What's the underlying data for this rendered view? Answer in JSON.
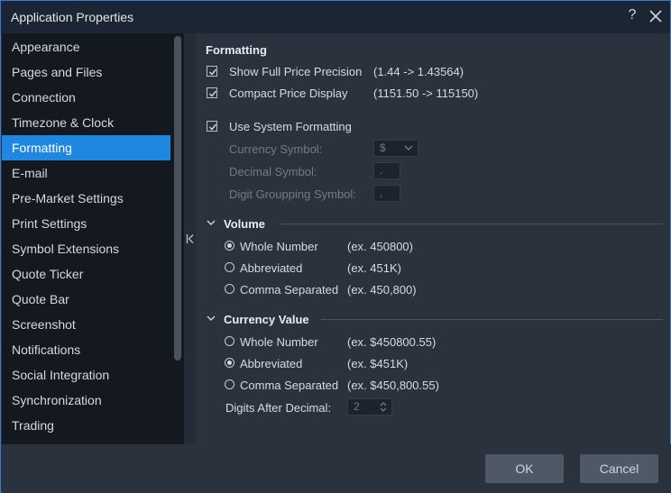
{
  "window": {
    "title": "Application Properties",
    "help_glyph": "?"
  },
  "sidebar": {
    "items": [
      {
        "label": "Appearance"
      },
      {
        "label": "Pages and Files"
      },
      {
        "label": "Connection"
      },
      {
        "label": "Timezone & Clock"
      },
      {
        "label": "Formatting",
        "active": true
      },
      {
        "label": "E-mail"
      },
      {
        "label": "Pre-Market Settings"
      },
      {
        "label": "Print Settings"
      },
      {
        "label": "Symbol Extensions"
      },
      {
        "label": "Quote Ticker"
      },
      {
        "label": "Quote Bar"
      },
      {
        "label": "Screenshot"
      },
      {
        "label": "Notifications"
      },
      {
        "label": "Social Integration"
      },
      {
        "label": "Synchronization"
      },
      {
        "label": "Trading"
      }
    ]
  },
  "formatting": {
    "header": "Formatting",
    "show_full_price": {
      "label": "Show Full Price Precision",
      "example": "(1.44 -> 1.43564)",
      "checked": true
    },
    "compact_price": {
      "label": "Compact Price Display",
      "example": "(1151.50 -> 115150)",
      "checked": true
    },
    "use_system": {
      "label": "Use System Formatting",
      "checked": true
    },
    "currency_symbol": {
      "label": "Currency Symbol:",
      "value": "$"
    },
    "decimal_symbol": {
      "label": "Decimal Symbol:",
      "value": "."
    },
    "digit_grouping": {
      "label": "Digit Groupping Symbol:",
      "value": ","
    }
  },
  "volume": {
    "header": "Volume",
    "options": [
      {
        "label": "Whole Number",
        "example": "(ex. 450800)",
        "selected": true
      },
      {
        "label": "Abbreviated",
        "example": "(ex. 451K)",
        "selected": false
      },
      {
        "label": "Comma Separated",
        "example": "(ex. 450,800)",
        "selected": false
      }
    ]
  },
  "currency_value": {
    "header": "Currency Value",
    "options": [
      {
        "label": "Whole Number",
        "example": "(ex. $450800.55)",
        "selected": false
      },
      {
        "label": "Abbreviated",
        "example": "(ex. $451K)",
        "selected": true
      },
      {
        "label": "Comma Separated",
        "example": "(ex. $450,800.55)",
        "selected": false
      }
    ],
    "digits_after_decimal": {
      "label": "Digits After Decimal:",
      "value": "2"
    }
  },
  "footer": {
    "ok_label": "OK",
    "cancel_label": "Cancel"
  },
  "colors": {
    "accent": "#1f87e0",
    "sidebar_bg": "#14191f",
    "panel_bg": "#2a323e",
    "title_bg": "#1c2533"
  }
}
